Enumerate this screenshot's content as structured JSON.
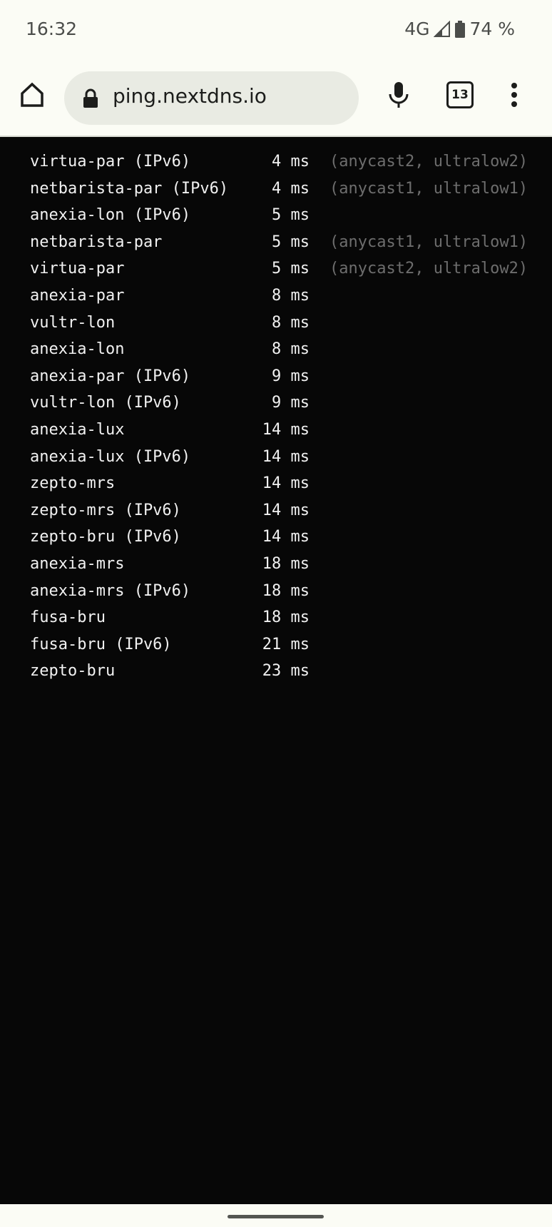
{
  "status_bar": {
    "time": "16:32",
    "network": "4G",
    "battery": "74 %"
  },
  "browser": {
    "url": "ping.nextdns.io",
    "tab_count": "13"
  },
  "icons": {
    "home": "home-icon",
    "lock": "lock-icon",
    "mic": "microphone-icon",
    "tabs": "tabs-icon",
    "menu": "more-vert-icon",
    "signal": "signal-icon",
    "battery": "battery-icon"
  },
  "colors": {
    "background": "#070707",
    "text": "#f1f1f1",
    "muted": "#6d6d6d",
    "chrome": "#fbfcf5"
  },
  "ping_results": [
    {
      "name": "virtua-par (IPv6)",
      "ms": "4 ms",
      "tags": "(anycast2, ultralow2)"
    },
    {
      "name": "netbarista-par (IPv6)",
      "ms": "4 ms",
      "tags": "(anycast1, ultralow1)"
    },
    {
      "name": "anexia-lon (IPv6)",
      "ms": "5 ms",
      "tags": ""
    },
    {
      "name": "netbarista-par",
      "ms": "5 ms",
      "tags": "(anycast1, ultralow1)"
    },
    {
      "name": "virtua-par",
      "ms": "5 ms",
      "tags": "(anycast2, ultralow2)"
    },
    {
      "name": "anexia-par",
      "ms": "8 ms",
      "tags": ""
    },
    {
      "name": "vultr-lon",
      "ms": "8 ms",
      "tags": ""
    },
    {
      "name": "anexia-lon",
      "ms": "8 ms",
      "tags": ""
    },
    {
      "name": "anexia-par (IPv6)",
      "ms": "9 ms",
      "tags": ""
    },
    {
      "name": "vultr-lon (IPv6)",
      "ms": "9 ms",
      "tags": ""
    },
    {
      "name": "anexia-lux",
      "ms": "14 ms",
      "tags": ""
    },
    {
      "name": "anexia-lux (IPv6)",
      "ms": "14 ms",
      "tags": ""
    },
    {
      "name": "zepto-mrs",
      "ms": "14 ms",
      "tags": ""
    },
    {
      "name": "zepto-mrs (IPv6)",
      "ms": "14 ms",
      "tags": ""
    },
    {
      "name": "zepto-bru (IPv6)",
      "ms": "14 ms",
      "tags": ""
    },
    {
      "name": "anexia-mrs",
      "ms": "18 ms",
      "tags": ""
    },
    {
      "name": "anexia-mrs (IPv6)",
      "ms": "18 ms",
      "tags": ""
    },
    {
      "name": "fusa-bru",
      "ms": "18 ms",
      "tags": ""
    },
    {
      "name": "fusa-bru (IPv6)",
      "ms": "21 ms",
      "tags": ""
    },
    {
      "name": "zepto-bru",
      "ms": "23 ms",
      "tags": ""
    }
  ]
}
